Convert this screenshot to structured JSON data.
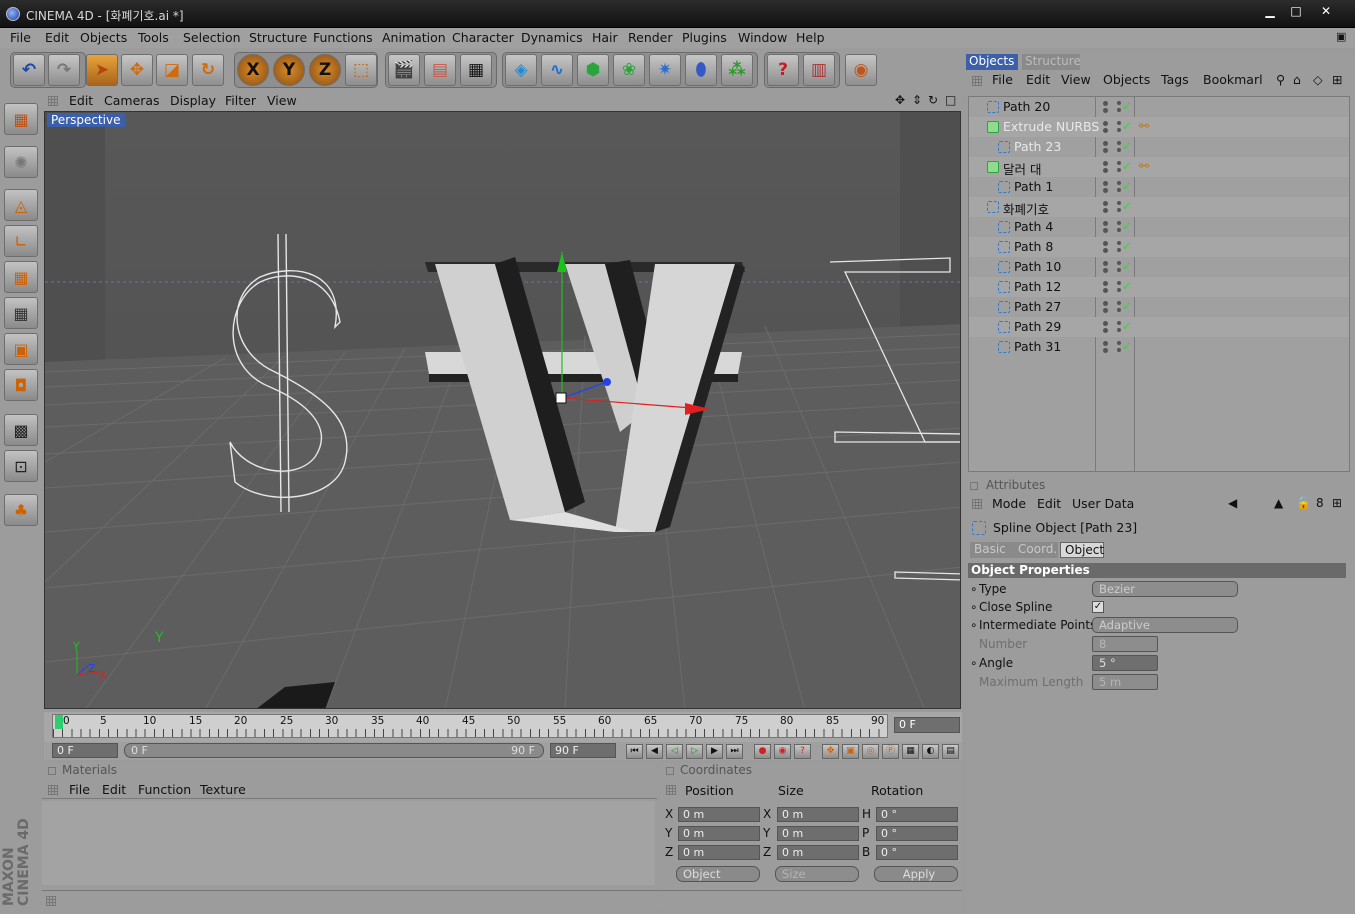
{
  "window": {
    "title": "CINEMA 4D - [화폐기호.ai *]",
    "min": "▁",
    "max": "□",
    "close": "✕"
  },
  "menubar": [
    "File",
    "Edit",
    "Objects",
    "Tools",
    "Selection",
    "Structure",
    "Functions",
    "Animation",
    "Character",
    "Dynamics",
    "Hair",
    "Render",
    "Plugins",
    "Window",
    "Help"
  ],
  "toolbar_icons": [
    "undo-icon",
    "redo-icon",
    "select-arrow-icon",
    "move-icon",
    "scale-icon",
    "rotate-icon",
    "x-axis-icon",
    "y-axis-icon",
    "z-axis-icon",
    "world-coords-icon",
    "render-view-icon",
    "render-picture-icon",
    "render-settings-icon",
    "cube-icon",
    "spline-icon",
    "nurbs-icon",
    "array-icon",
    "deformer-icon",
    "scene-icon",
    "particles-icon",
    "help-icon",
    "render-region-icon",
    "web-icon"
  ],
  "axes": {
    "x": "X",
    "y": "Y",
    "z": "Z"
  },
  "viewport": {
    "menu": [
      "Edit",
      "Cameras",
      "Display",
      "Filter",
      "View"
    ],
    "label": "Perspective",
    "axis_x": "X",
    "axis_y": "Y",
    "axis_z": "Z"
  },
  "timeline": {
    "ticks": [
      "0",
      "5",
      "10",
      "15",
      "20",
      "25",
      "30",
      "35",
      "40",
      "45",
      "50",
      "55",
      "60",
      "65",
      "70",
      "75",
      "80",
      "85",
      "90"
    ],
    "current_frame": "0 F",
    "start": "0 F",
    "range_left": "0 F",
    "range_right": "90 F",
    "end": "90 F"
  },
  "materials": {
    "title": "Materials",
    "menu": [
      "File",
      "Edit",
      "Function",
      "Texture"
    ]
  },
  "coordinates": {
    "title": "Coordinates",
    "headers": [
      "Position",
      "Size",
      "Rotation"
    ],
    "rows": [
      {
        "a": "X",
        "pos": "0 m",
        "b": "X",
        "size": "0 m",
        "c": "H",
        "rot": "0 °"
      },
      {
        "a": "Y",
        "pos": "0 m",
        "b": "Y",
        "size": "0 m",
        "c": "P",
        "rot": "0 °"
      },
      {
        "a": "Z",
        "pos": "0 m",
        "b": "Z",
        "size": "0 m",
        "c": "B",
        "rot": "0 °"
      }
    ],
    "mode": "Object",
    "size_mode": "Size",
    "apply": "Apply"
  },
  "objects": {
    "tabs": [
      "Objects",
      "Structure"
    ],
    "menu": [
      "File",
      "Edit",
      "View",
      "Objects",
      "Tags",
      "Bookmarl"
    ],
    "tree": [
      {
        "name": "Path 20",
        "indent": 0,
        "selected": false
      },
      {
        "name": "Extrude NURBS",
        "indent": 0,
        "selected": true
      },
      {
        "name": "Path 23",
        "indent": 1,
        "selected": true
      },
      {
        "name": "달러 대",
        "indent": 0,
        "selected": false
      },
      {
        "name": "Path 1",
        "indent": 1,
        "selected": false
      },
      {
        "name": "화폐기호",
        "indent": 0,
        "selected": false
      },
      {
        "name": "Path 4",
        "indent": 1,
        "selected": false
      },
      {
        "name": "Path 8",
        "indent": 1,
        "selected": false
      },
      {
        "name": "Path 10",
        "indent": 1,
        "selected": false
      },
      {
        "name": "Path 12",
        "indent": 1,
        "selected": false
      },
      {
        "name": "Path 27",
        "indent": 1,
        "selected": false
      },
      {
        "name": "Path 29",
        "indent": 1,
        "selected": false
      },
      {
        "name": "Path 31",
        "indent": 1,
        "selected": false
      }
    ]
  },
  "attributes": {
    "title": "Attributes",
    "menu": [
      "Mode",
      "Edit",
      "User Data"
    ],
    "object": "Spline Object [Path 23]",
    "tabs": [
      "Basic",
      "Coord.",
      "Object"
    ],
    "section": "Object Properties",
    "props": {
      "type_label": "Type",
      "type_value": "Bezier",
      "close_label": "Close Spline",
      "interp_label": "Intermediate Points",
      "interp_value": "Adaptive",
      "number_label": "Number",
      "number_value": "8",
      "angle_label": "Angle",
      "angle_value": "5 °",
      "maxlen_label": "Maximum Length",
      "maxlen_value": "5 m"
    }
  },
  "brand": "MAXON CINEMA 4D"
}
